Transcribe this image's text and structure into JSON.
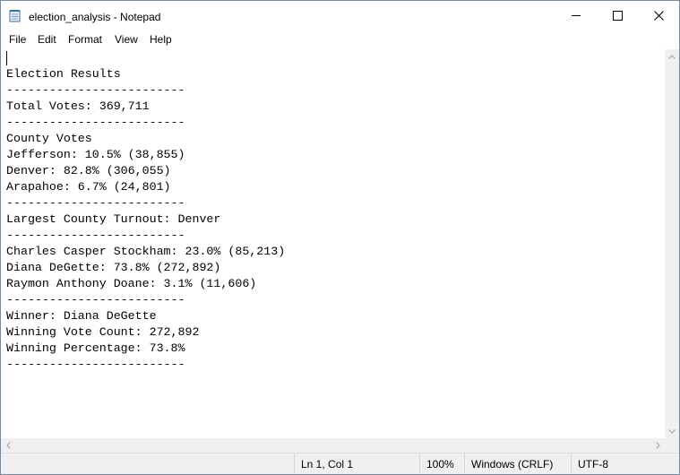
{
  "window": {
    "title": "election_analysis - Notepad"
  },
  "menu": [
    "File",
    "Edit",
    "Format",
    "View",
    "Help"
  ],
  "document": {
    "lines": [
      "Election Results",
      "-------------------------",
      "Total Votes: 369,711",
      "-------------------------",
      "County Votes",
      "Jefferson: 10.5% (38,855)",
      "Denver: 82.8% (306,055)",
      "Arapahoe: 6.7% (24,801)",
      "-------------------------",
      "Largest County Turnout: Denver",
      "-------------------------",
      "Charles Casper Stockham: 23.0% (85,213)",
      "Diana DeGette: 73.8% (272,892)",
      "Raymon Anthony Doane: 3.1% (11,606)",
      "-------------------------",
      "Winner: Diana DeGette",
      "Winning Vote Count: 272,892",
      "Winning Percentage: 73.8%",
      "-------------------------"
    ]
  },
  "status": {
    "position": "Ln 1, Col 1",
    "zoom": "100%",
    "line_endings": "Windows (CRLF)",
    "encoding": "UTF-8"
  },
  "icons": {
    "app": "notepad-icon",
    "minimize": "minimize-icon",
    "maximize": "maximize-icon",
    "close": "close-icon"
  }
}
